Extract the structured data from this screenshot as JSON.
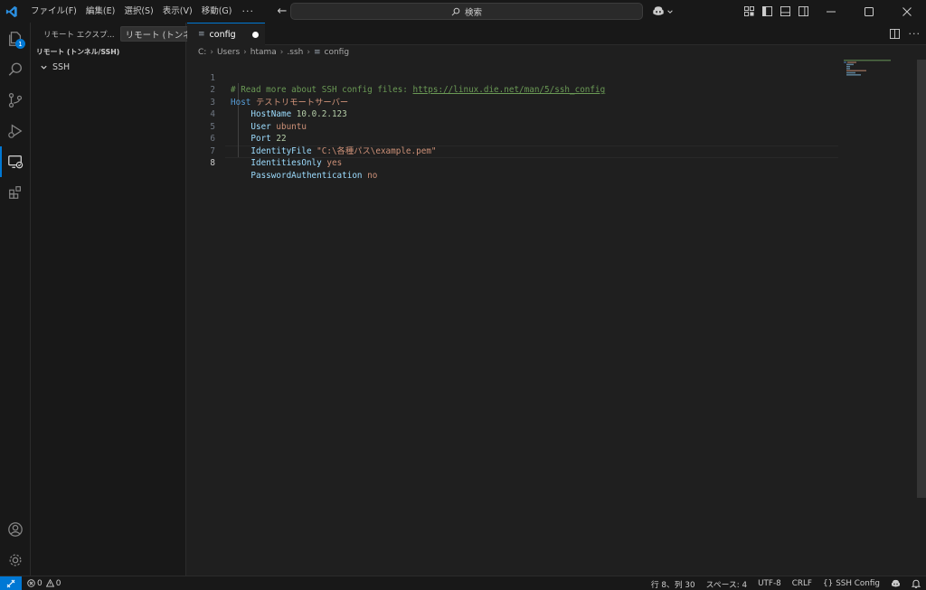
{
  "titlebar": {
    "menus": [
      "ファイル(F)",
      "編集(E)",
      "選択(S)",
      "表示(V)",
      "移動(G)"
    ],
    "more": "···",
    "search_placeholder": "検索"
  },
  "activity": {
    "explorer_badge": "1"
  },
  "sidebar": {
    "tab_label": "リモート エクスプ...",
    "dropdown_value": "リモート (トンネ",
    "more": "···",
    "section_title": "リモート (トンネル/SSH)",
    "tree": [
      {
        "label": "SSH"
      }
    ]
  },
  "tabs": [
    {
      "label": "config"
    }
  ],
  "breadcrumb": [
    "C:",
    "Users",
    "htama",
    ".ssh",
    "config"
  ],
  "editor": {
    "line_numbers": [
      "1",
      "2",
      "3",
      "4",
      "5",
      "6",
      "7",
      "8"
    ],
    "comment_prefix": "# Read more about SSH config files: ",
    "comment_link": "https://linux.die.net/man/5/ssh_config",
    "host_keyword": "Host",
    "host_name": "テストリモートサーバー",
    "entries": [
      {
        "key": "HostName",
        "value": "10.0.2.123"
      },
      {
        "key": "User",
        "value": "ubuntu"
      },
      {
        "key": "Port",
        "value": "22"
      },
      {
        "key": "IdentityFile",
        "value": "\"C:\\各種パス\\example.pem\""
      },
      {
        "key": "IdentitiesOnly",
        "value": "yes"
      },
      {
        "key": "PasswordAuthentication",
        "value": "no"
      }
    ]
  },
  "statusbar": {
    "errors": "0",
    "warnings": "0",
    "position": "行 8、列 30",
    "spaces": "スペース: 4",
    "encoding": "UTF-8",
    "eol": "CRLF",
    "language": "SSH Config"
  },
  "colors": {
    "accent": "#0078d4",
    "background": "#1f1f1f",
    "chrome": "#181818"
  }
}
